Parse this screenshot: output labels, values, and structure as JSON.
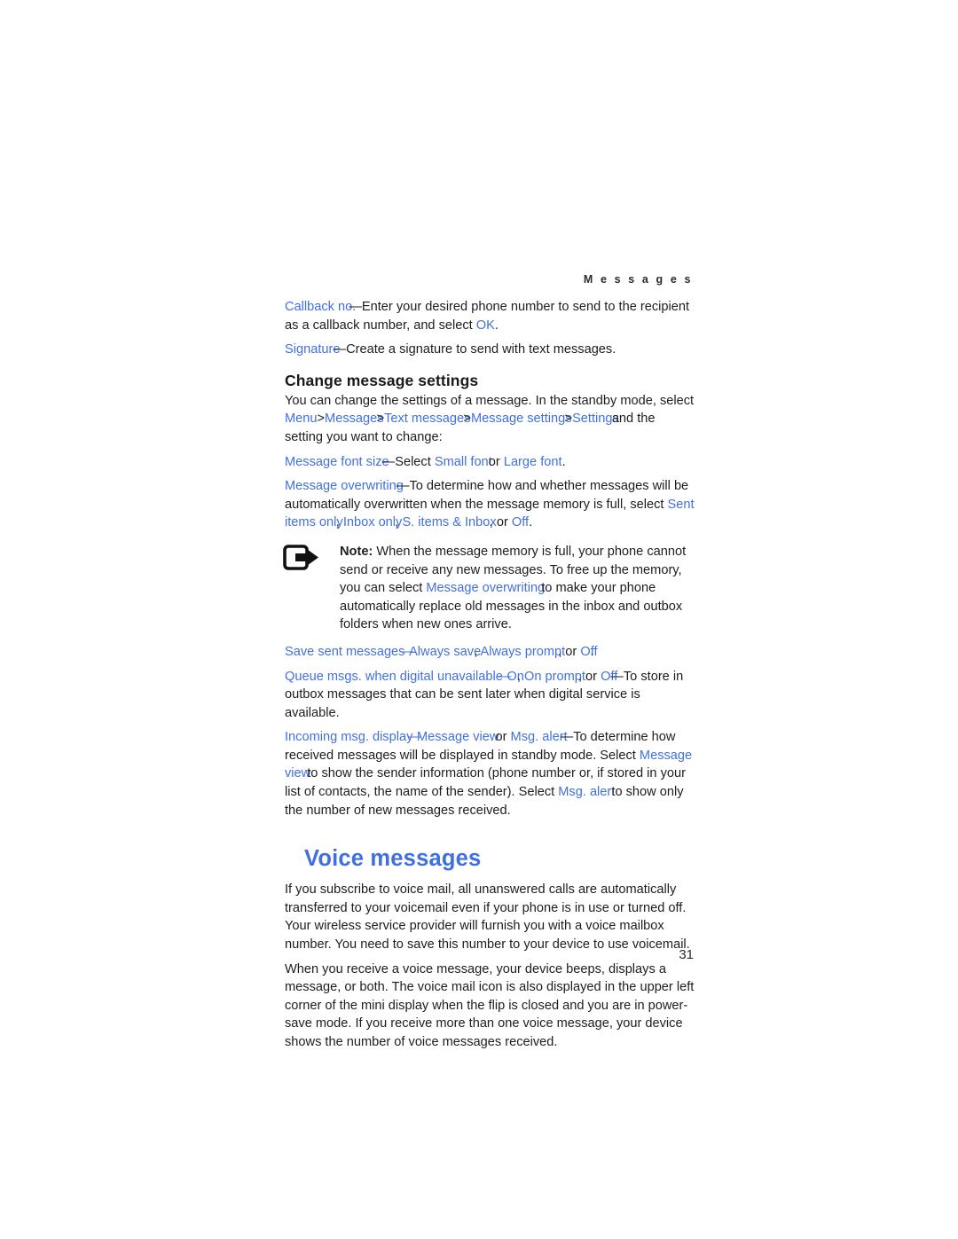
{
  "page": {
    "running_header": "M e s s a g e s",
    "folio": "31",
    "accent_blue": "#4170e0",
    "body_color": "#1d1d1d",
    "background": "#ffffff"
  },
  "content": {
    "callback": {
      "term": "Callback no.",
      "text_a": "—Enter your desired phone number to send to the recipient as a callback number, and select ",
      "term_b": "OK",
      "text_b": "."
    },
    "signature": {
      "term": "Signature",
      "text": "—Create a signature to send with text messages."
    },
    "change_settings_heading": "Change message settings",
    "change_settings_intro": {
      "lead": "You can change the settings of a message. In the standby mode, select ",
      "nav": [
        "Menu",
        "Messages",
        "Text messages",
        "Message settings",
        "Settings"
      ],
      "separator": ">",
      "tail": "and the setting you want to change:"
    },
    "font_size": {
      "term": "Message font size",
      "text_a": "—Select ",
      "opt_a": "Small font",
      "text_b": " or ",
      "opt_b": "Large font",
      "text_c": "."
    },
    "overwriting": {
      "term": "Message overwriting",
      "text_a": "—To determine how and whether messages will be automatically overwritten when the message memory is full, select ",
      "opt_a": "Sent items only",
      "sep_a": ", ",
      "opt_b": "Inbox only",
      "sep_b": ", ",
      "opt_c": "S. items & Inbox",
      "sep_c": ", or ",
      "opt_d": "Off",
      "text_b": "."
    },
    "note": {
      "icon": "note-arrow-icon",
      "label": "Note:",
      "text_a": " When the message memory is full, your phone cannot send or receive any new messages. To free up the memory, you can select ",
      "term": "Message overwriting",
      "text_b": " to make your phone automatically replace old messages in the inbox and outbox folders when new ones arrive."
    },
    "save_sent": {
      "term": "Save sent messages",
      "text_a": "—",
      "opt_a": "Always save",
      "sep_a": ", ",
      "opt_b": "Always prompt",
      "sep_b": ", or ",
      "opt_c": "Off",
      "text_b": "."
    },
    "queue": {
      "term": "Queue msgs. when digital unavailable",
      "text_a": "—",
      "opt_a": "On",
      "sep_a": ", ",
      "opt_b": "On prompt",
      "sep_b": ", or ",
      "opt_c": "Off",
      "text_b": "—To store in outbox messages that can be sent later when digital service is available."
    },
    "incoming": {
      "term": "Incoming msg. display",
      "text_a": "—",
      "opt_a": "Message view",
      "sep_a": " or ",
      "opt_b": "Msg. alert",
      "text_b": "—To determine how received messages will be displayed in standby mode. Select ",
      "opt_c": "Message view",
      "text_c": " to show the sender information (phone number or, if stored in your list of contacts, the name of the sender). Select ",
      "opt_d": "Msg. alert",
      "text_d": " to show only the number of new messages received."
    },
    "voice_heading": "Voice messages",
    "voice_p1": "If you subscribe to voice mail, all unanswered calls are automatically transferred to your voicemail even if your phone is in use or turned off. Your wireless service provider will furnish you with a voice mailbox number. You need to save this number to your device to use voicemail.",
    "voice_p2": "When you receive a voice message, your device beeps, displays a message, or both. The voice mail icon is also displayed in the upper left corner of the mini display when the flip is closed and you are in power-save mode. If you receive more than one voice message, your device shows the number of voice messages received."
  }
}
